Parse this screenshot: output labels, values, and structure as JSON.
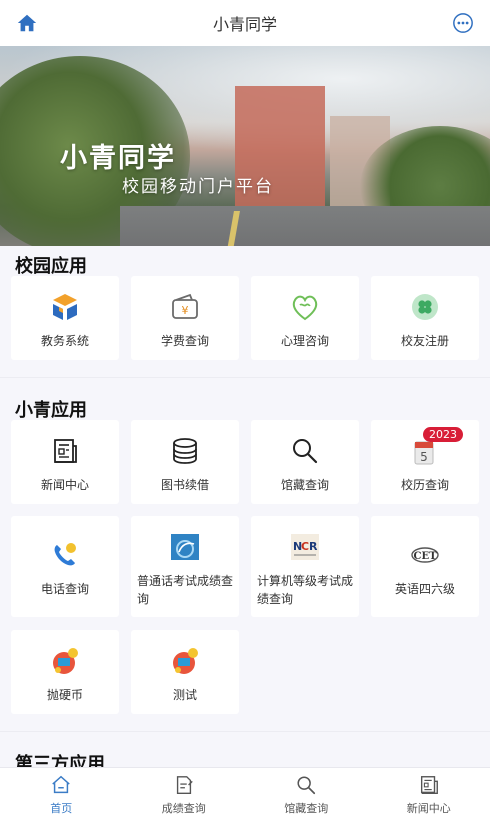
{
  "header": {
    "title": "小青同学"
  },
  "banner": {
    "title": "小青同学",
    "subtitle": "校园移动门户平台"
  },
  "campus_apps": {
    "title": "校园应用",
    "items": [
      {
        "label": "教务系统",
        "icon": "academic-system-icon"
      },
      {
        "label": "学费查询",
        "icon": "wallet-icon"
      },
      {
        "label": "心理咨询",
        "icon": "heart-mind-icon"
      },
      {
        "label": "校友注册",
        "icon": "clover-icon"
      }
    ]
  },
  "xiaoqing_apps": {
    "title": "小青应用",
    "items": [
      {
        "label": "新闻中心",
        "icon": "newspaper-icon"
      },
      {
        "label": "图书续借",
        "icon": "books-icon"
      },
      {
        "label": "馆藏查询",
        "icon": "search-icon"
      },
      {
        "label": "校历查询",
        "icon": "calendar-icon",
        "badge": "2023"
      },
      {
        "label": "电话查询",
        "icon": "phone-icon"
      },
      {
        "label": "普通话考试成绩查询",
        "icon": "mandarin-exam-icon"
      },
      {
        "label": "计算机等级考试成绩查询",
        "icon": "ncre-icon"
      },
      {
        "label": "英语四六级",
        "icon": "cet-icon"
      },
      {
        "label": "抛硬币",
        "icon": "coin-toss-icon"
      },
      {
        "label": "测试",
        "icon": "coin-toss-icon"
      }
    ]
  },
  "third_party_apps": {
    "title": "第三方应用"
  },
  "tabbar": {
    "items": [
      {
        "label": "首页",
        "icon": "home-icon",
        "active": true
      },
      {
        "label": "成绩查询",
        "icon": "edit-doc-icon"
      },
      {
        "label": "馆藏查询",
        "icon": "search-icon"
      },
      {
        "label": "新闻中心",
        "icon": "newspaper-icon"
      }
    ]
  },
  "colors": {
    "accent": "#3b7cc6",
    "badge": "#d81e37",
    "background": "#f6f6fb"
  }
}
